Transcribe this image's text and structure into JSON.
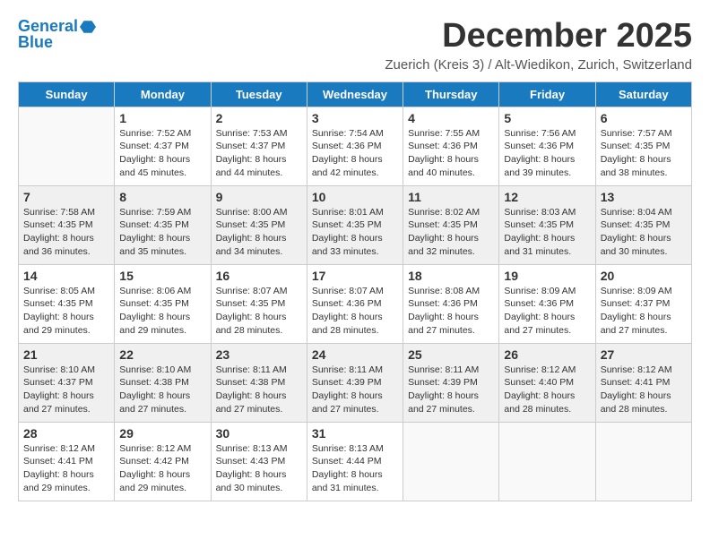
{
  "header": {
    "logo_line1": "General",
    "logo_line2": "Blue",
    "month_title": "December 2025",
    "subtitle": "Zuerich (Kreis 3) / Alt-Wiedikon, Zurich, Switzerland"
  },
  "weekdays": [
    "Sunday",
    "Monday",
    "Tuesday",
    "Wednesday",
    "Thursday",
    "Friday",
    "Saturday"
  ],
  "weeks": [
    [
      {
        "day": "",
        "info": ""
      },
      {
        "day": "1",
        "info": "Sunrise: 7:52 AM\nSunset: 4:37 PM\nDaylight: 8 hours\nand 45 minutes."
      },
      {
        "day": "2",
        "info": "Sunrise: 7:53 AM\nSunset: 4:37 PM\nDaylight: 8 hours\nand 44 minutes."
      },
      {
        "day": "3",
        "info": "Sunrise: 7:54 AM\nSunset: 4:36 PM\nDaylight: 8 hours\nand 42 minutes."
      },
      {
        "day": "4",
        "info": "Sunrise: 7:55 AM\nSunset: 4:36 PM\nDaylight: 8 hours\nand 40 minutes."
      },
      {
        "day": "5",
        "info": "Sunrise: 7:56 AM\nSunset: 4:36 PM\nDaylight: 8 hours\nand 39 minutes."
      },
      {
        "day": "6",
        "info": "Sunrise: 7:57 AM\nSunset: 4:35 PM\nDaylight: 8 hours\nand 38 minutes."
      }
    ],
    [
      {
        "day": "7",
        "info": "Sunrise: 7:58 AM\nSunset: 4:35 PM\nDaylight: 8 hours\nand 36 minutes."
      },
      {
        "day": "8",
        "info": "Sunrise: 7:59 AM\nSunset: 4:35 PM\nDaylight: 8 hours\nand 35 minutes."
      },
      {
        "day": "9",
        "info": "Sunrise: 8:00 AM\nSunset: 4:35 PM\nDaylight: 8 hours\nand 34 minutes."
      },
      {
        "day": "10",
        "info": "Sunrise: 8:01 AM\nSunset: 4:35 PM\nDaylight: 8 hours\nand 33 minutes."
      },
      {
        "day": "11",
        "info": "Sunrise: 8:02 AM\nSunset: 4:35 PM\nDaylight: 8 hours\nand 32 minutes."
      },
      {
        "day": "12",
        "info": "Sunrise: 8:03 AM\nSunset: 4:35 PM\nDaylight: 8 hours\nand 31 minutes."
      },
      {
        "day": "13",
        "info": "Sunrise: 8:04 AM\nSunset: 4:35 PM\nDaylight: 8 hours\nand 30 minutes."
      }
    ],
    [
      {
        "day": "14",
        "info": "Sunrise: 8:05 AM\nSunset: 4:35 PM\nDaylight: 8 hours\nand 29 minutes."
      },
      {
        "day": "15",
        "info": "Sunrise: 8:06 AM\nSunset: 4:35 PM\nDaylight: 8 hours\nand 29 minutes."
      },
      {
        "day": "16",
        "info": "Sunrise: 8:07 AM\nSunset: 4:35 PM\nDaylight: 8 hours\nand 28 minutes."
      },
      {
        "day": "17",
        "info": "Sunrise: 8:07 AM\nSunset: 4:36 PM\nDaylight: 8 hours\nand 28 minutes."
      },
      {
        "day": "18",
        "info": "Sunrise: 8:08 AM\nSunset: 4:36 PM\nDaylight: 8 hours\nand 27 minutes."
      },
      {
        "day": "19",
        "info": "Sunrise: 8:09 AM\nSunset: 4:36 PM\nDaylight: 8 hours\nand 27 minutes."
      },
      {
        "day": "20",
        "info": "Sunrise: 8:09 AM\nSunset: 4:37 PM\nDaylight: 8 hours\nand 27 minutes."
      }
    ],
    [
      {
        "day": "21",
        "info": "Sunrise: 8:10 AM\nSunset: 4:37 PM\nDaylight: 8 hours\nand 27 minutes."
      },
      {
        "day": "22",
        "info": "Sunrise: 8:10 AM\nSunset: 4:38 PM\nDaylight: 8 hours\nand 27 minutes."
      },
      {
        "day": "23",
        "info": "Sunrise: 8:11 AM\nSunset: 4:38 PM\nDaylight: 8 hours\nand 27 minutes."
      },
      {
        "day": "24",
        "info": "Sunrise: 8:11 AM\nSunset: 4:39 PM\nDaylight: 8 hours\nand 27 minutes."
      },
      {
        "day": "25",
        "info": "Sunrise: 8:11 AM\nSunset: 4:39 PM\nDaylight: 8 hours\nand 27 minutes."
      },
      {
        "day": "26",
        "info": "Sunrise: 8:12 AM\nSunset: 4:40 PM\nDaylight: 8 hours\nand 28 minutes."
      },
      {
        "day": "27",
        "info": "Sunrise: 8:12 AM\nSunset: 4:41 PM\nDaylight: 8 hours\nand 28 minutes."
      }
    ],
    [
      {
        "day": "28",
        "info": "Sunrise: 8:12 AM\nSunset: 4:41 PM\nDaylight: 8 hours\nand 29 minutes."
      },
      {
        "day": "29",
        "info": "Sunrise: 8:12 AM\nSunset: 4:42 PM\nDaylight: 8 hours\nand 29 minutes."
      },
      {
        "day": "30",
        "info": "Sunrise: 8:13 AM\nSunset: 4:43 PM\nDaylight: 8 hours\nand 30 minutes."
      },
      {
        "day": "31",
        "info": "Sunrise: 8:13 AM\nSunset: 4:44 PM\nDaylight: 8 hours\nand 31 minutes."
      },
      {
        "day": "",
        "info": ""
      },
      {
        "day": "",
        "info": ""
      },
      {
        "day": "",
        "info": ""
      }
    ]
  ]
}
